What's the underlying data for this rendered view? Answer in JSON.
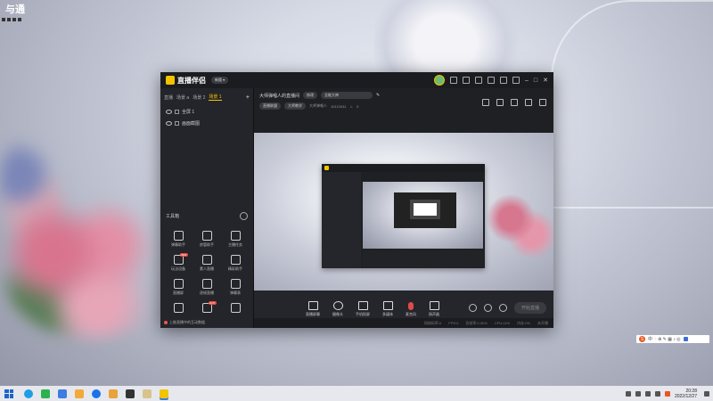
{
  "desktop": {
    "icon_label": "与通"
  },
  "app": {
    "name": "直播伴侣",
    "version_pill": "新版 ▾",
    "scene_tabs": [
      "直播",
      "场景 a",
      "场景 2",
      "场景 1"
    ],
    "active_scene_index": 3,
    "sources": [
      {
        "label": "全屏 1"
      },
      {
        "label": "画面截图"
      }
    ],
    "toolbox": {
      "title": "工具箱",
      "tools": [
        {
          "label": "弹幕助手",
          "icon": "comment-icon"
        },
        {
          "label": "房管助手",
          "icon": "user-icon"
        },
        {
          "label": "主播任务",
          "icon": "task-icon"
        },
        {
          "label": "玩法设备",
          "icon": "gamepad-icon",
          "badge": "NEW"
        },
        {
          "label": "素人直播",
          "icon": "download-icon"
        },
        {
          "label": "精彩助手",
          "icon": "highlight-icon"
        },
        {
          "label": "直播屏",
          "icon": "screen-icon"
        },
        {
          "label": "逐帧直播",
          "icon": "frame-icon"
        },
        {
          "label": "弹幕表",
          "icon": "table-icon"
        },
        {
          "label": "",
          "icon": "doc-icon"
        },
        {
          "label": "",
          "icon": "video-icon",
          "badge": "HOT"
        },
        {
          "label": "",
          "icon": "download-icon"
        }
      ]
    },
    "notice": "上推直播中的互动数据",
    "room": {
      "title": "大师弹唱人的直播间",
      "edit_label": "修改",
      "topic_pill": "全能大神",
      "tags": [
        "直播联盟",
        "大师教学"
      ],
      "streamer": "大师弹唱人",
      "id": "10121511",
      "likes": "0"
    },
    "controls": [
      {
        "label": "直播屏幕",
        "icon": "screen-share-icon"
      },
      {
        "label": "摄像头",
        "icon": "camera-icon"
      },
      {
        "label": "手机投屏",
        "icon": "phone-cast-icon"
      },
      {
        "label": "多媒体",
        "icon": "media-icon"
      },
      {
        "label": "麦克风",
        "icon": "mic-icon"
      },
      {
        "label": "扬声器",
        "icon": "speaker-icon"
      }
    ],
    "start_button": "开始直播",
    "status": [
      "网络码率:0",
      "FPS:0",
      "丢帧率:0.00%",
      "CPU:11%",
      "内存:0%",
      "未开播"
    ]
  },
  "ime": {
    "label": "中",
    "extra": "·  ⊕  ✎  ▦  ♪  ◎"
  },
  "taskbar": {
    "time": "20:28",
    "date": "2022/12/27"
  },
  "colors": {
    "accent": "#f3c300",
    "window_bg": "#1f2024",
    "live_red": "#e24a4a"
  }
}
